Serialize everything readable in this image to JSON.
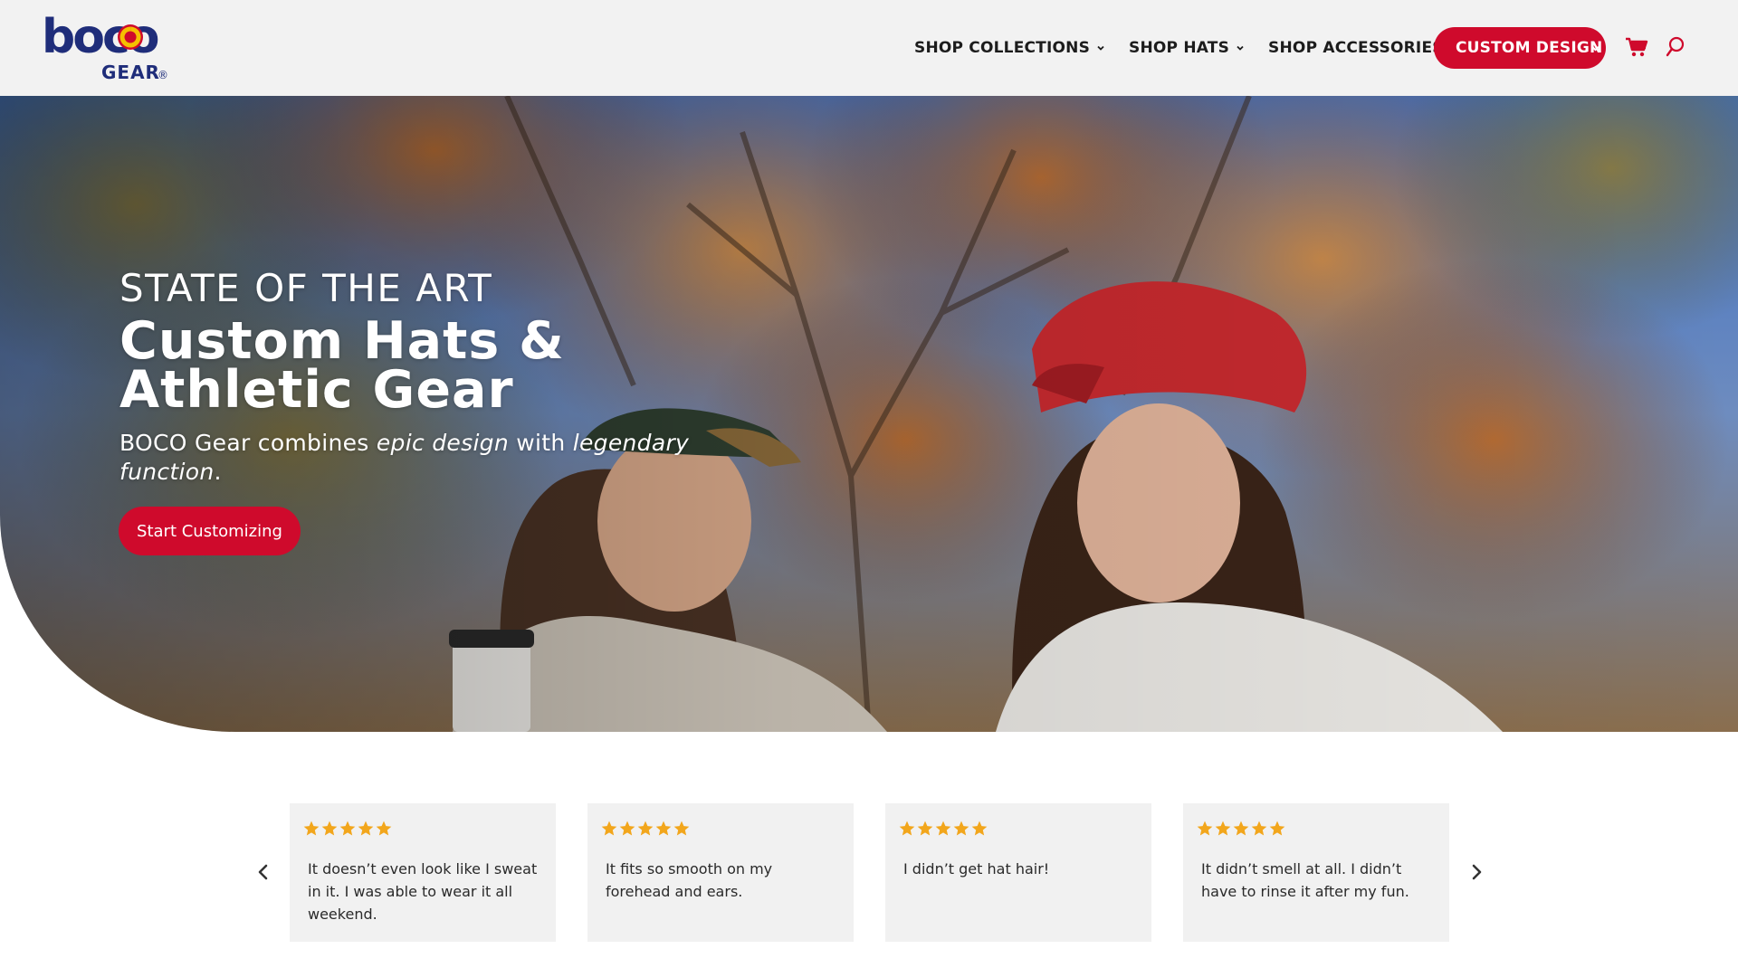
{
  "logo": {
    "wordmark": "boco",
    "sub": "GEAR",
    "trademark": "®"
  },
  "nav": {
    "items": [
      {
        "label": "SHOP COLLECTIONS"
      },
      {
        "label": "SHOP HATS"
      },
      {
        "label": "SHOP ACCESSORIES"
      }
    ],
    "cta_label": "CUSTOM DESIGN"
  },
  "hero": {
    "eyebrow": "STATE OF THE ART",
    "title": "Custom Hats & Athletic Gear",
    "sub_part1": "BOCO Gear combines ",
    "sub_em1": "epic design",
    "sub_part2": " with ",
    "sub_em2": "legendary function",
    "sub_part3": ".",
    "button_label": "Start Customizing"
  },
  "reviews": {
    "items": [
      {
        "rating": 5,
        "text": "It doesn’t even look like I sweat in it. I was able to wear it all weekend."
      },
      {
        "rating": 5,
        "text": "It fits so smooth on my forehead and ears."
      },
      {
        "rating": 5,
        "text": "I didn’t get hat hair!"
      },
      {
        "rating": 5,
        "text": "It didn’t smell at all. I didn’t have to rinse it after my fun."
      }
    ]
  },
  "colors": {
    "brand_red": "#cf0a2c",
    "brand_navy": "#1f2d7a",
    "star_gold": "#f2a61c",
    "header_bg": "#f2f2f2",
    "card_bg": "#f1f1f1"
  },
  "icons": [
    "chevron-down-icon",
    "cart-icon",
    "search-icon",
    "chevron-left-icon",
    "chevron-right-icon",
    "star-icon"
  ]
}
